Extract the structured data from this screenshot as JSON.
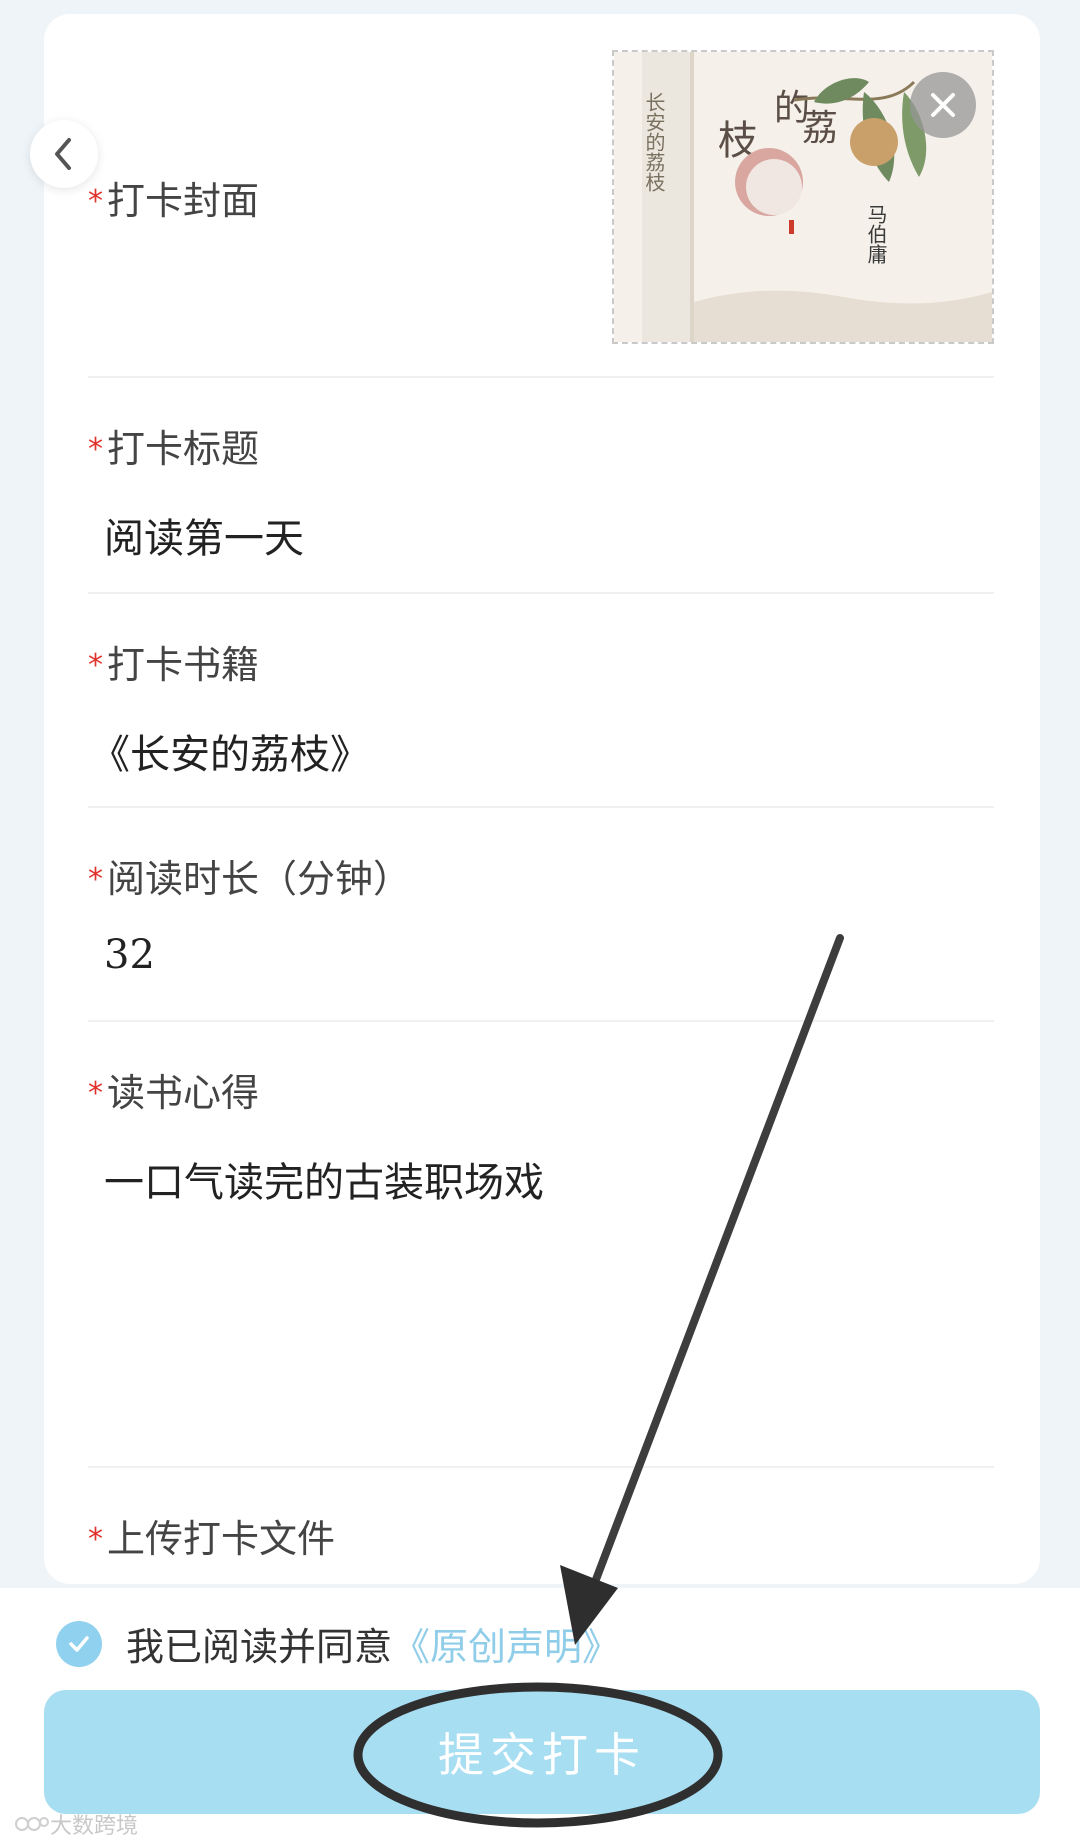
{
  "form": {
    "cover": {
      "label": "打卡封面"
    },
    "title": {
      "label": "打卡标题",
      "value": "阅读第一天"
    },
    "book": {
      "label": "打卡书籍",
      "value": "《长安的荔枝》"
    },
    "duration": {
      "label": "阅读时长（分钟）",
      "value": "32"
    },
    "notes": {
      "label": "读书心得",
      "value": "一口气读完的古装职场戏"
    },
    "upload": {
      "label": "上传打卡文件"
    },
    "required_mark": "*"
  },
  "cover_art": {
    "title_chars": [
      "的",
      "荔",
      "枝"
    ],
    "spine_text": "长安的荔枝",
    "author": "马伯庸",
    "colors": {
      "bg": "#f5f1ea",
      "spine": "#ece7de",
      "fruit": "#d9a6a0",
      "leaf": "#6f8a5f",
      "stripe": "#cc3a2c"
    }
  },
  "agreement": {
    "checked": true,
    "text": "我已阅读并同意",
    "link": "《原创声明》"
  },
  "submit": {
    "label": "提交打卡"
  },
  "watermark": {
    "text": "大数跨境"
  },
  "colors": {
    "accent": "#8fcde9",
    "button": "#a8def2",
    "required": "#e0322d",
    "page_bg": "#eef4f8"
  },
  "icons": {
    "back": "chevron-left-icon",
    "close": "close-icon",
    "check": "check-icon"
  }
}
